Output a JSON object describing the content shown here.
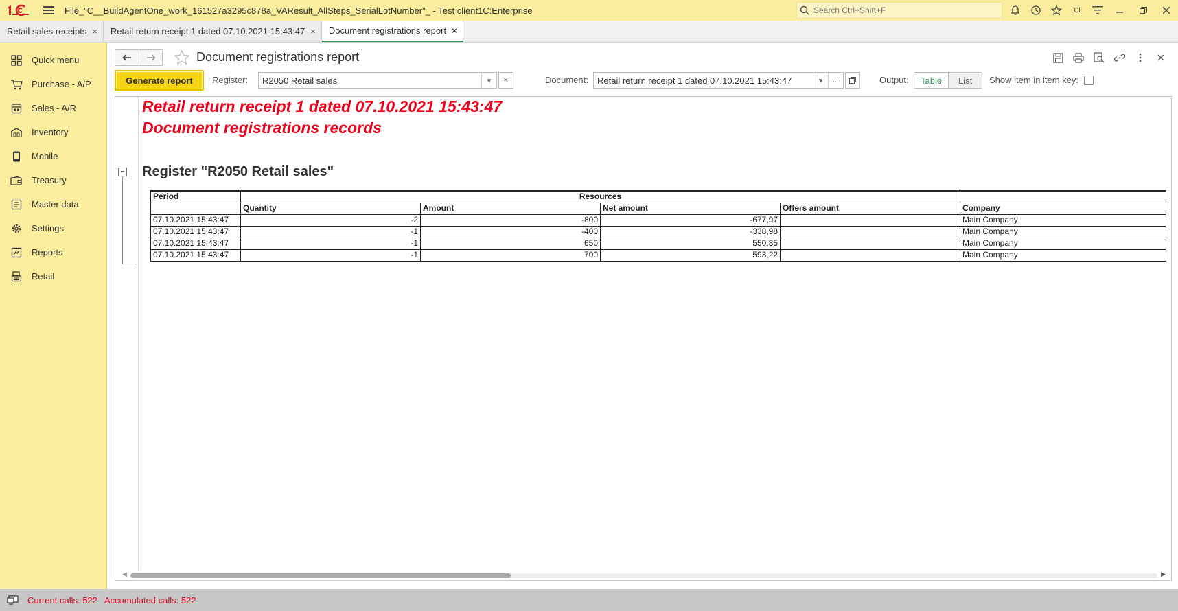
{
  "titlebar": {
    "title": "File_\"C__BuildAgentOne_work_161527a3295c878a_VAResult_AllSteps_SerialLotNumber\"_  - Test client1C:Enterprise",
    "search_placeholder": "Search Ctrl+Shift+F",
    "user_abbrev": "Cl"
  },
  "tabs": [
    {
      "label": "Retail sales receipts",
      "close": "×"
    },
    {
      "label": "Retail return receipt 1 dated 07.10.2021 15:43:47",
      "close": "×"
    },
    {
      "label": "Document registrations report",
      "close": "×"
    }
  ],
  "sidebar": {
    "items": [
      {
        "label": "Quick menu",
        "icon": "grid-icon"
      },
      {
        "label": "Purchase  - A/P",
        "icon": "cart-icon"
      },
      {
        "label": "Sales - A/R",
        "icon": "store-icon"
      },
      {
        "label": "Inventory",
        "icon": "warehouse-icon"
      },
      {
        "label": "Mobile",
        "icon": "phone-icon"
      },
      {
        "label": "Treasury",
        "icon": "wallet-icon"
      },
      {
        "label": "Master data",
        "icon": "database-icon"
      },
      {
        "label": "Settings",
        "icon": "gear-icon"
      },
      {
        "label": "Reports",
        "icon": "chart-icon"
      },
      {
        "label": "Retail",
        "icon": "cash-register-icon"
      }
    ]
  },
  "page": {
    "title": "Document registrations report"
  },
  "toolbar": {
    "generate_label": "Generate report",
    "register_label": "Register:",
    "register_value": "R2050 Retail sales",
    "document_label": "Document:",
    "document_value": "Retail return receipt 1 dated 07.10.2021 15:43:47",
    "output_label": "Output:",
    "output_options": [
      "Table",
      "List"
    ],
    "output_selected": "Table",
    "show_item_label": "Show item in item key:",
    "clear_glyph": "×",
    "dropdown_glyph": "▾",
    "ellipsis_glyph": "..."
  },
  "report": {
    "title1": "Retail return receipt 1 dated 07.10.2021 15:43:47",
    "title2": "Document registrations records",
    "register_title": "Register  \"R2050 Retail sales\"",
    "headers": {
      "period": "Period",
      "resources": "Resources",
      "quantity": "Quantity",
      "amount": "Amount",
      "net_amount": "Net amount",
      "offers_amount": "Offers amount",
      "company": "Company"
    },
    "rows": [
      {
        "period": "07.10.2021 15:43:47",
        "quantity": "-2",
        "amount": "-800",
        "net_amount": "-677,97",
        "offers_amount": "",
        "company": "Main Company"
      },
      {
        "period": "07.10.2021 15:43:47",
        "quantity": "-1",
        "amount": "-400",
        "net_amount": "-338,98",
        "offers_amount": "",
        "company": "Main Company"
      },
      {
        "period": "07.10.2021 15:43:47",
        "quantity": "-1",
        "amount": "650",
        "net_amount": "550,85",
        "offers_amount": "",
        "company": "Main Company"
      },
      {
        "period": "07.10.2021 15:43:47",
        "quantity": "-1",
        "amount": "700",
        "net_amount": "593,22",
        "offers_amount": "",
        "company": "Main Company"
      }
    ]
  },
  "statusbar": {
    "current_calls": "Current calls: 522",
    "accumulated_calls": "Accumulated calls: 522"
  },
  "colors": {
    "sidebar_bg": "#fbed9e",
    "accent_green": "#3a8a5a",
    "report_red": "#e8001c",
    "generate_button": "#f5d317",
    "statusbar_bg": "#c7c7c7"
  }
}
